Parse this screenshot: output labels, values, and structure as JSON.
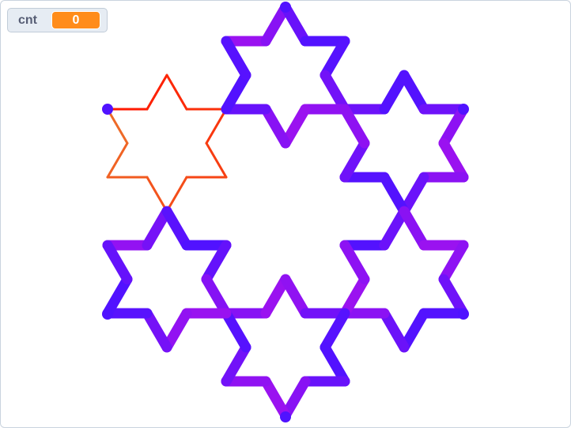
{
  "monitor": {
    "label": "cnt",
    "value": "0"
  },
  "colors": {
    "monitor_value_bg": "#ff8c1a",
    "pen_first_segment_start": "#ff1a00",
    "pen_first_segment_end": "#ee6a28",
    "pen_blue": "#5012ff",
    "pen_purple": "#9a12f0"
  }
}
